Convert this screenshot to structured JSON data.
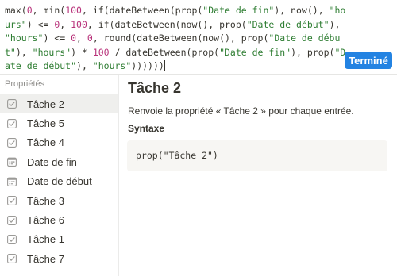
{
  "formula": {
    "tokens": [
      {
        "t": "max(",
        "c": ""
      },
      {
        "t": "0",
        "c": "n"
      },
      {
        "t": ", min(",
        "c": ""
      },
      {
        "t": "100",
        "c": "n"
      },
      {
        "t": ", if(dateBetween(prop(",
        "c": ""
      },
      {
        "t": "\"Date de fin\"",
        "c": "s"
      },
      {
        "t": "), now(), ",
        "c": ""
      },
      {
        "t": "\"hours\"",
        "c": "s"
      },
      {
        "t": ") <= ",
        "c": ""
      },
      {
        "t": "0",
        "c": "n"
      },
      {
        "t": ", ",
        "c": ""
      },
      {
        "t": "100",
        "c": "n"
      },
      {
        "t": ", if(dateBetween(now(), prop(",
        "c": ""
      },
      {
        "t": "\"Date de début\"",
        "c": "s"
      },
      {
        "t": "), ",
        "c": ""
      },
      {
        "t": "\"hours\"",
        "c": "s"
      },
      {
        "t": ") <= ",
        "c": ""
      },
      {
        "t": "0",
        "c": "n"
      },
      {
        "t": ", ",
        "c": ""
      },
      {
        "t": "0",
        "c": "n"
      },
      {
        "t": ", round(dateBetween(now(), prop(",
        "c": ""
      },
      {
        "t": "\"Date de début\"",
        "c": "s"
      },
      {
        "t": "), ",
        "c": ""
      },
      {
        "t": "\"hours\"",
        "c": "s"
      },
      {
        "t": ") * ",
        "c": ""
      },
      {
        "t": "100",
        "c": "n"
      },
      {
        "t": " / dateBetween(prop(",
        "c": ""
      },
      {
        "t": "\"Date de fin\"",
        "c": "s"
      },
      {
        "t": "), prop(",
        "c": ""
      },
      {
        "t": "\"Date de début\"",
        "c": "s"
      },
      {
        "t": "), ",
        "c": ""
      },
      {
        "t": "\"hours\"",
        "c": "s"
      },
      {
        "t": "))))))",
        "c": ""
      }
    ]
  },
  "done_button": "Terminé",
  "sidebar": {
    "heading": "Propriétés",
    "items": [
      {
        "label": "Tâche 2",
        "icon": "checkbox-icon",
        "active": true
      },
      {
        "label": "Tâche 5",
        "icon": "checkbox-icon",
        "active": false
      },
      {
        "label": "Tâche 4",
        "icon": "checkbox-icon",
        "active": false
      },
      {
        "label": "Date de fin",
        "icon": "calendar-icon",
        "active": false
      },
      {
        "label": "Date de début",
        "icon": "calendar-icon",
        "active": false
      },
      {
        "label": "Tâche 3",
        "icon": "checkbox-icon",
        "active": false
      },
      {
        "label": "Tâche 6",
        "icon": "checkbox-icon",
        "active": false
      },
      {
        "label": "Tâche 1",
        "icon": "checkbox-icon",
        "active": false
      },
      {
        "label": "Tâche 7",
        "icon": "checkbox-icon",
        "active": false
      }
    ]
  },
  "detail": {
    "title": "Tâche 2",
    "description": "Renvoie la propriété « Tâche 2 » pour chaque entrée.",
    "syntax_heading": "Syntaxe",
    "syntax_code": "prop(\"Tâche 2\")"
  },
  "colors": {
    "accent": "#2383e2",
    "string": "#2e7d32",
    "number": "#b8327a",
    "active_bg": "#efefed"
  }
}
